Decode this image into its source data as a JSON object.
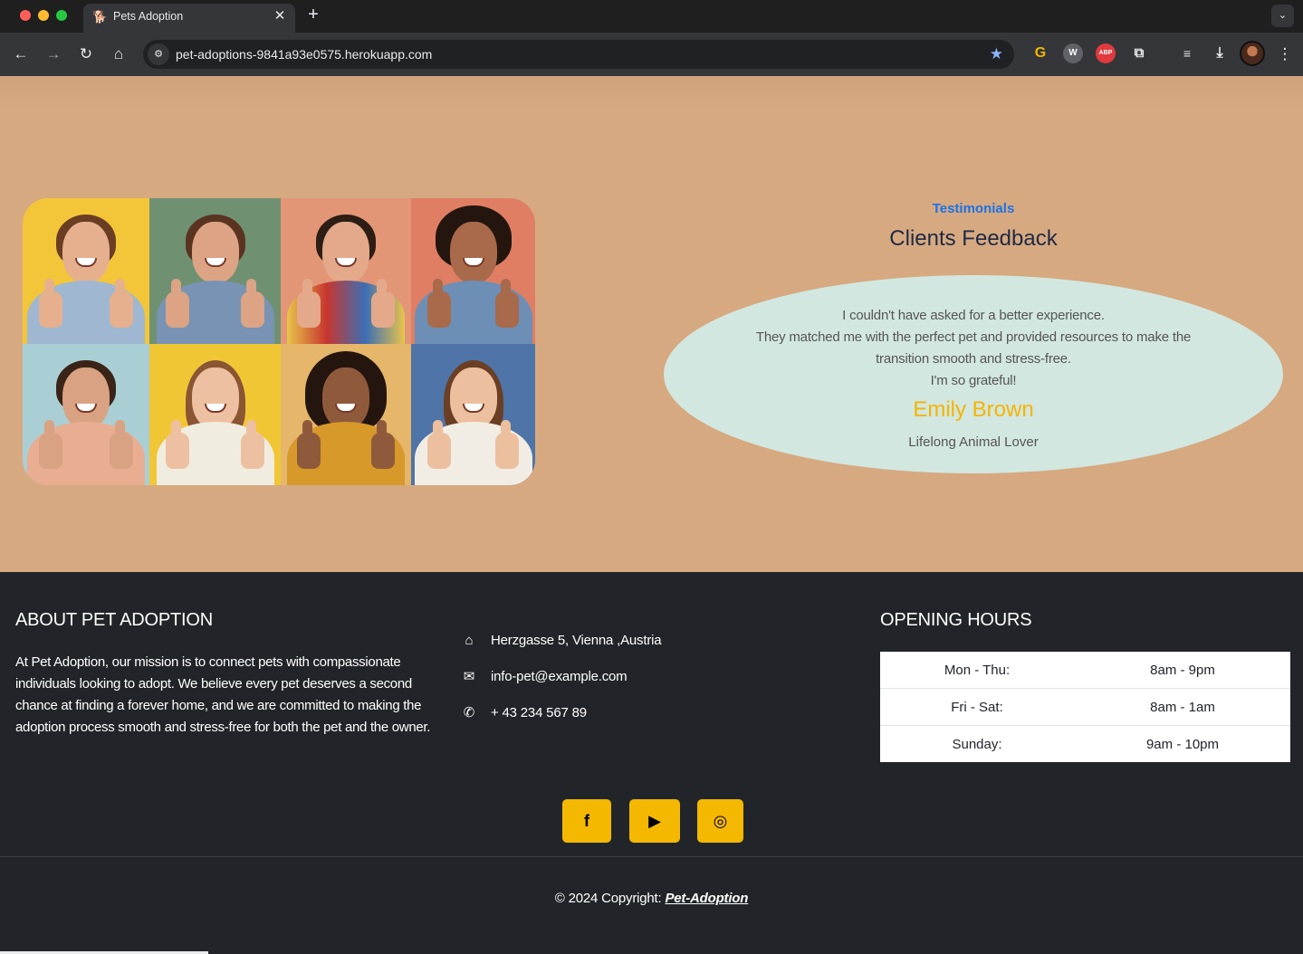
{
  "browser": {
    "tab_title": "Pets Adoption",
    "tab_close": "✕",
    "new_tab": "+",
    "url": "pet-adoptions-9841a93e0575.herokuapp.com",
    "extensions": [
      "grammarly-icon",
      "wappalyzer-icon",
      "adblock-plus-icon",
      "extensions-icon",
      "media-controls-icon",
      "downloads-icon"
    ],
    "abp_label": "ABP"
  },
  "testimonials": {
    "label": "Testimonials",
    "title": "Clients Feedback",
    "quote_lines": [
      "I couldn't have asked for a better experience.",
      "They matched me with the perfect pet and provided resources to make the",
      "transition smooth and stress-free.",
      "I'm so grateful!"
    ],
    "author_name": "Emily Brown",
    "author_role": "Lifelong Animal Lover"
  },
  "footer": {
    "about_heading": "ABOUT PET ADOPTION",
    "about_text": "At Pet Adoption, our mission is to connect pets with compassionate individuals looking to adopt. We believe every pet deserves a second chance at finding a forever home, and we are committed to making the adoption process smooth and stress-free for both the pet and the owner.",
    "contact": {
      "address": "Herzgasse 5, Vienna ,Austria",
      "email": "info-pet@example.com",
      "phone": "+ 43 234 567 89"
    },
    "hours_heading": "OPENING HOURS",
    "hours": [
      {
        "day": "Mon - Thu:",
        "time": "8am - 9pm"
      },
      {
        "day": "Fri - Sat:",
        "time": "8am - 1am"
      },
      {
        "day": "Sunday:",
        "time": "9am - 10pm"
      }
    ],
    "social": [
      "facebook-icon",
      "youtube-icon",
      "instagram-icon"
    ],
    "copyright_prefix": "© 2024 Copyright: ",
    "copyright_link": "Pet-Adoption"
  },
  "colors": {
    "testimonial_bg": "#d6a981",
    "bubble_bg": "#d2e7df",
    "accent_yellow": "#f5b400",
    "label_blue": "#1a73e8",
    "footer_bg": "#212529"
  }
}
